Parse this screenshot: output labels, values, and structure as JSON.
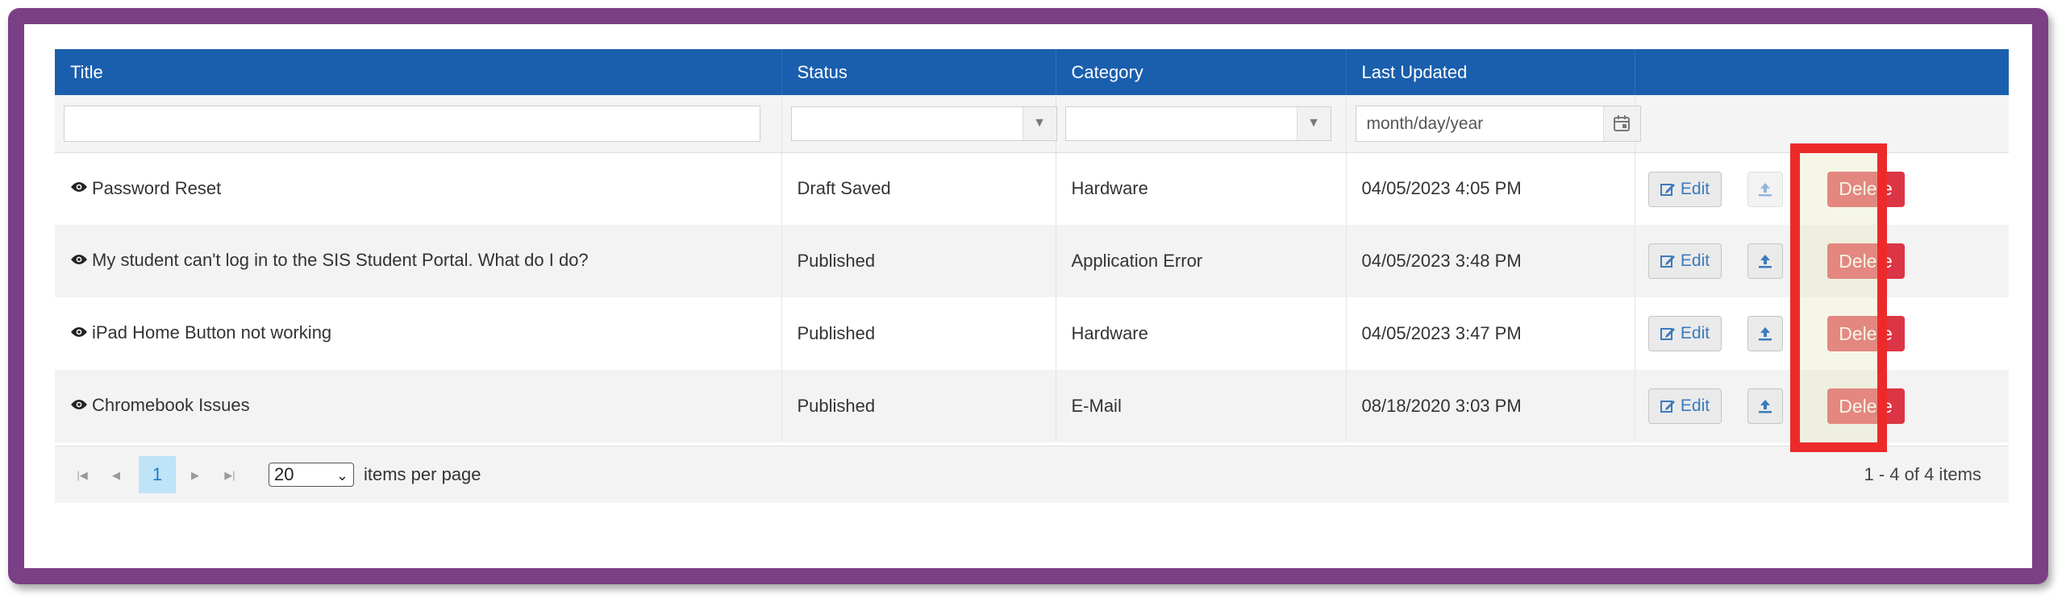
{
  "columns": [
    "Title",
    "Status",
    "Category",
    "Last Updated",
    ""
  ],
  "filters": {
    "date_placeholder": "month/day/year"
  },
  "rows": [
    {
      "title": "Password Reset",
      "status": "Draft Saved",
      "category": "Hardware",
      "updated": "04/05/2023 4:05 PM",
      "publish_enabled": false
    },
    {
      "title": "My student can't log in to the SIS Student Portal. What do I do?",
      "status": "Published",
      "category": "Application Error",
      "updated": "04/05/2023 3:48 PM",
      "publish_enabled": true
    },
    {
      "title": "iPad Home Button not working",
      "status": "Published",
      "category": "Hardware",
      "updated": "04/05/2023 3:47 PM",
      "publish_enabled": true
    },
    {
      "title": "Chromebook Issues",
      "status": "Published",
      "category": "E-Mail",
      "updated": "08/18/2020 3:03 PM",
      "publish_enabled": true
    }
  ],
  "actions": {
    "edit_label": "Edit",
    "delete_label": "Delete"
  },
  "pager": {
    "current_page": "1",
    "page_size": "20",
    "per_page_label": "items per page",
    "info": "1 - 4 of 4 items"
  },
  "colors": {
    "frame": "#7b3f85",
    "header": "#1a5fae",
    "delete": "#dc3545",
    "highlight": "#ec2a2a",
    "icon_blue": "#3a7bbd"
  },
  "icons": [
    "eye-icon",
    "edit-icon",
    "upload-icon",
    "calendar-icon",
    "dropdown-caret-icon",
    "first-page-icon",
    "prev-page-icon",
    "next-page-icon",
    "last-page-icon"
  ]
}
